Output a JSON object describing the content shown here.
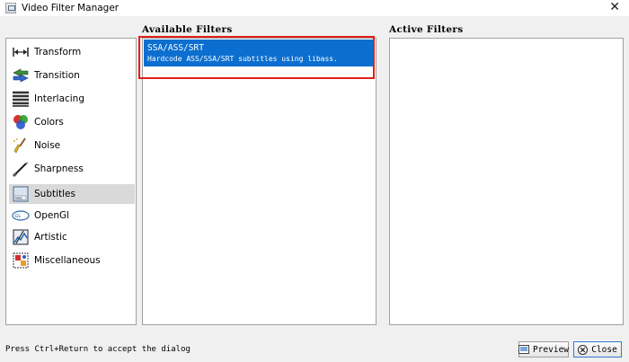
{
  "window": {
    "title": "Video Filter Manager",
    "close_glyph": "✕"
  },
  "categories": [
    {
      "label": "Transform",
      "icon": "transform-icon"
    },
    {
      "label": "Transition",
      "icon": "transition-icon"
    },
    {
      "label": "Interlacing",
      "icon": "interlacing-icon"
    },
    {
      "label": "Colors",
      "icon": "colors-icon"
    },
    {
      "label": "Noise",
      "icon": "noise-icon"
    },
    {
      "label": "Sharpness",
      "icon": "sharpness-icon"
    },
    {
      "label": "Subtitles",
      "icon": "subtitles-icon",
      "selected": true
    },
    {
      "label": "OpenGl",
      "icon": "opengl-icon"
    },
    {
      "label": "Artistic",
      "icon": "artistic-icon"
    },
    {
      "label": "Miscellaneous",
      "icon": "miscellaneous-icon"
    }
  ],
  "available": {
    "heading": "Available Filters",
    "items": [
      {
        "name": "SSA/ASS/SRT",
        "description": "Hardcode ASS/SSA/SRT subtitles using libass."
      }
    ]
  },
  "active": {
    "heading": "Active Filters",
    "items": []
  },
  "footer": {
    "hint": "Press Ctrl+Return to accept the dialog",
    "preview_label": "Preview",
    "close_label": "Close"
  },
  "colors": {
    "selection": "#0c6fd0",
    "highlight_box": "#e0201b",
    "category_selected": "#d9d9d9"
  }
}
